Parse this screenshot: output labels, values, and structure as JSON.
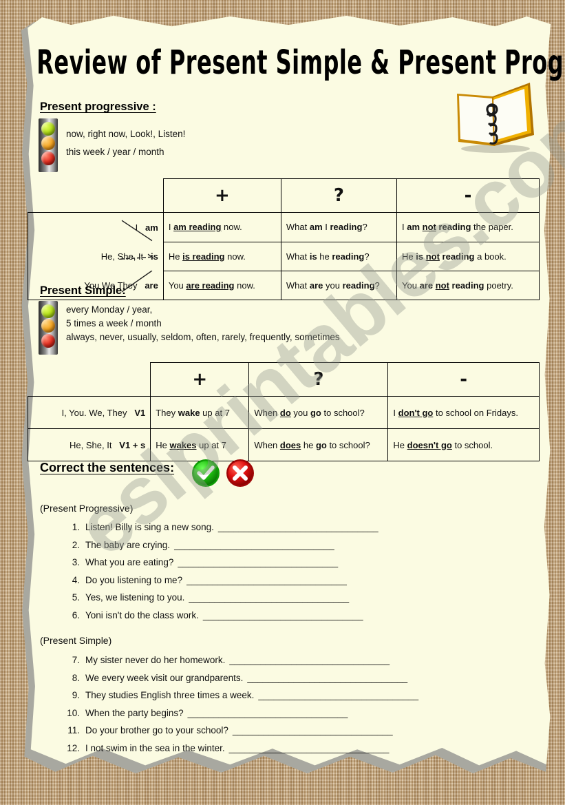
{
  "worksheet": {
    "title": "Review of Present Simple & Present Progressive",
    "watermark": "eslprintables.com"
  },
  "present_progressive": {
    "heading": "Present progressive :",
    "cues": [
      "now, right now, Look!,  Listen!",
      "this week / year / month"
    ],
    "table": {
      "headers": [
        "+",
        "?",
        "-"
      ],
      "rows": [
        {
          "pronouns": "I",
          "be": "am",
          "positive_pre": "I ",
          "positive_bold": "am reading",
          "positive_post": " now.",
          "question_pre": "What ",
          "question_bold1": "am",
          "question_mid": " I ",
          "question_bold2": "reading",
          "question_post": "?",
          "negative_pre": "I ",
          "negative_bold1": "am ",
          "negative_bold2": "not",
          "negative_bold3": " reading",
          "negative_post": " the paper."
        },
        {
          "pronouns": "He, She, It",
          "be": "is",
          "positive_pre": "He ",
          "positive_bold": "is reading",
          "positive_post": " now.",
          "question_pre": "What ",
          "question_bold1": "is",
          "question_mid": " he ",
          "question_bold2": "reading",
          "question_post": "?",
          "negative_pre": "He ",
          "negative_bold1": "is ",
          "negative_bold2": "not",
          "negative_bold3": " reading",
          "negative_post": " a book."
        },
        {
          "pronouns": "You We They",
          "be": "are",
          "positive_pre": "You ",
          "positive_bold": "are reading",
          "positive_post": " now.",
          "question_pre": "What ",
          "question_bold1": "are",
          "question_mid": " you ",
          "question_bold2": "reading",
          "question_post": "?",
          "negative_pre": "You ",
          "negative_bold1": "are ",
          "negative_bold2": "not",
          "negative_bold3": " reading",
          "negative_post": " poetry."
        }
      ]
    }
  },
  "present_simple": {
    "heading": "Present Simple:",
    "cues": [
      "every Monday / year,",
      "5 times a week / month",
      "always, never, usually, seldom, often, rarely, frequently, sometimes"
    ],
    "table": {
      "headers": [
        "+",
        "?",
        "-"
      ],
      "rows": [
        {
          "pronouns": "I, You. We, They",
          "verb_form": "V1",
          "positive_pre": "They ",
          "positive_bold": "wake",
          "positive_post": " up at 7",
          "question_pre": "When ",
          "question_bold1": "do",
          "question_mid": " you ",
          "question_bold2": "go",
          "question_post": " to school?",
          "negative_pre": "I ",
          "negative_bold1": "don't go",
          "negative_post": " to school on Fridays."
        },
        {
          "pronouns": "He, She, It",
          "verb_form": "V1 + s",
          "positive_pre": "He ",
          "positive_bold": "wakes",
          "positive_post": " up at 7",
          "question_pre": "When ",
          "question_bold1": "does",
          "question_mid": " he ",
          "question_bold2": "go",
          "question_post": " to school?",
          "negative_pre": "He ",
          "negative_bold1": "doesn't go",
          "negative_post": " to school."
        }
      ]
    }
  },
  "exercise": {
    "heading": "Correct the sentences:",
    "icons": {
      "check": "check-circle-icon",
      "cross": "cross-circle-icon",
      "check_color": "#1fc010",
      "cross_color": "#d61414"
    },
    "group_progressive_label": "(Present Progressive)",
    "group_simple_label": "(Present Simple)",
    "blank": "_______________________________",
    "items_progressive": [
      {
        "num": "1.",
        "text": "Listen! Billy is sing a new song."
      },
      {
        "num": "2.",
        "text": "The baby are crying."
      },
      {
        "num": "3.",
        "text": "What you are eating?"
      },
      {
        "num": "4.",
        "text": "Do you listening to me?"
      },
      {
        "num": "5.",
        "text": "Yes, we listening to you."
      },
      {
        "num": "6.",
        "text": "Yoni isn't do the class work."
      }
    ],
    "items_simple": [
      {
        "num": "7.",
        "text": "My sister never do her homework."
      },
      {
        "num": "8.",
        "text": "We every week visit our grandparents."
      },
      {
        "num": "9.",
        "text": "They studies English three times a week."
      },
      {
        "num": "10.",
        "text": "When the party begins?"
      },
      {
        "num": "11.",
        "text": "Do your brother go to your school?"
      },
      {
        "num": "12.",
        "text": "I not swim in the sea in the winter."
      }
    ]
  },
  "colors": {
    "paper": "#fbfbe2",
    "burlap": "#c9a87b",
    "shadow": "#a8a8a0",
    "light_green": "#b4e01a",
    "light_amber": "#f5a623",
    "light_red": "#e33022",
    "notebook_cover": "#e8a800"
  }
}
